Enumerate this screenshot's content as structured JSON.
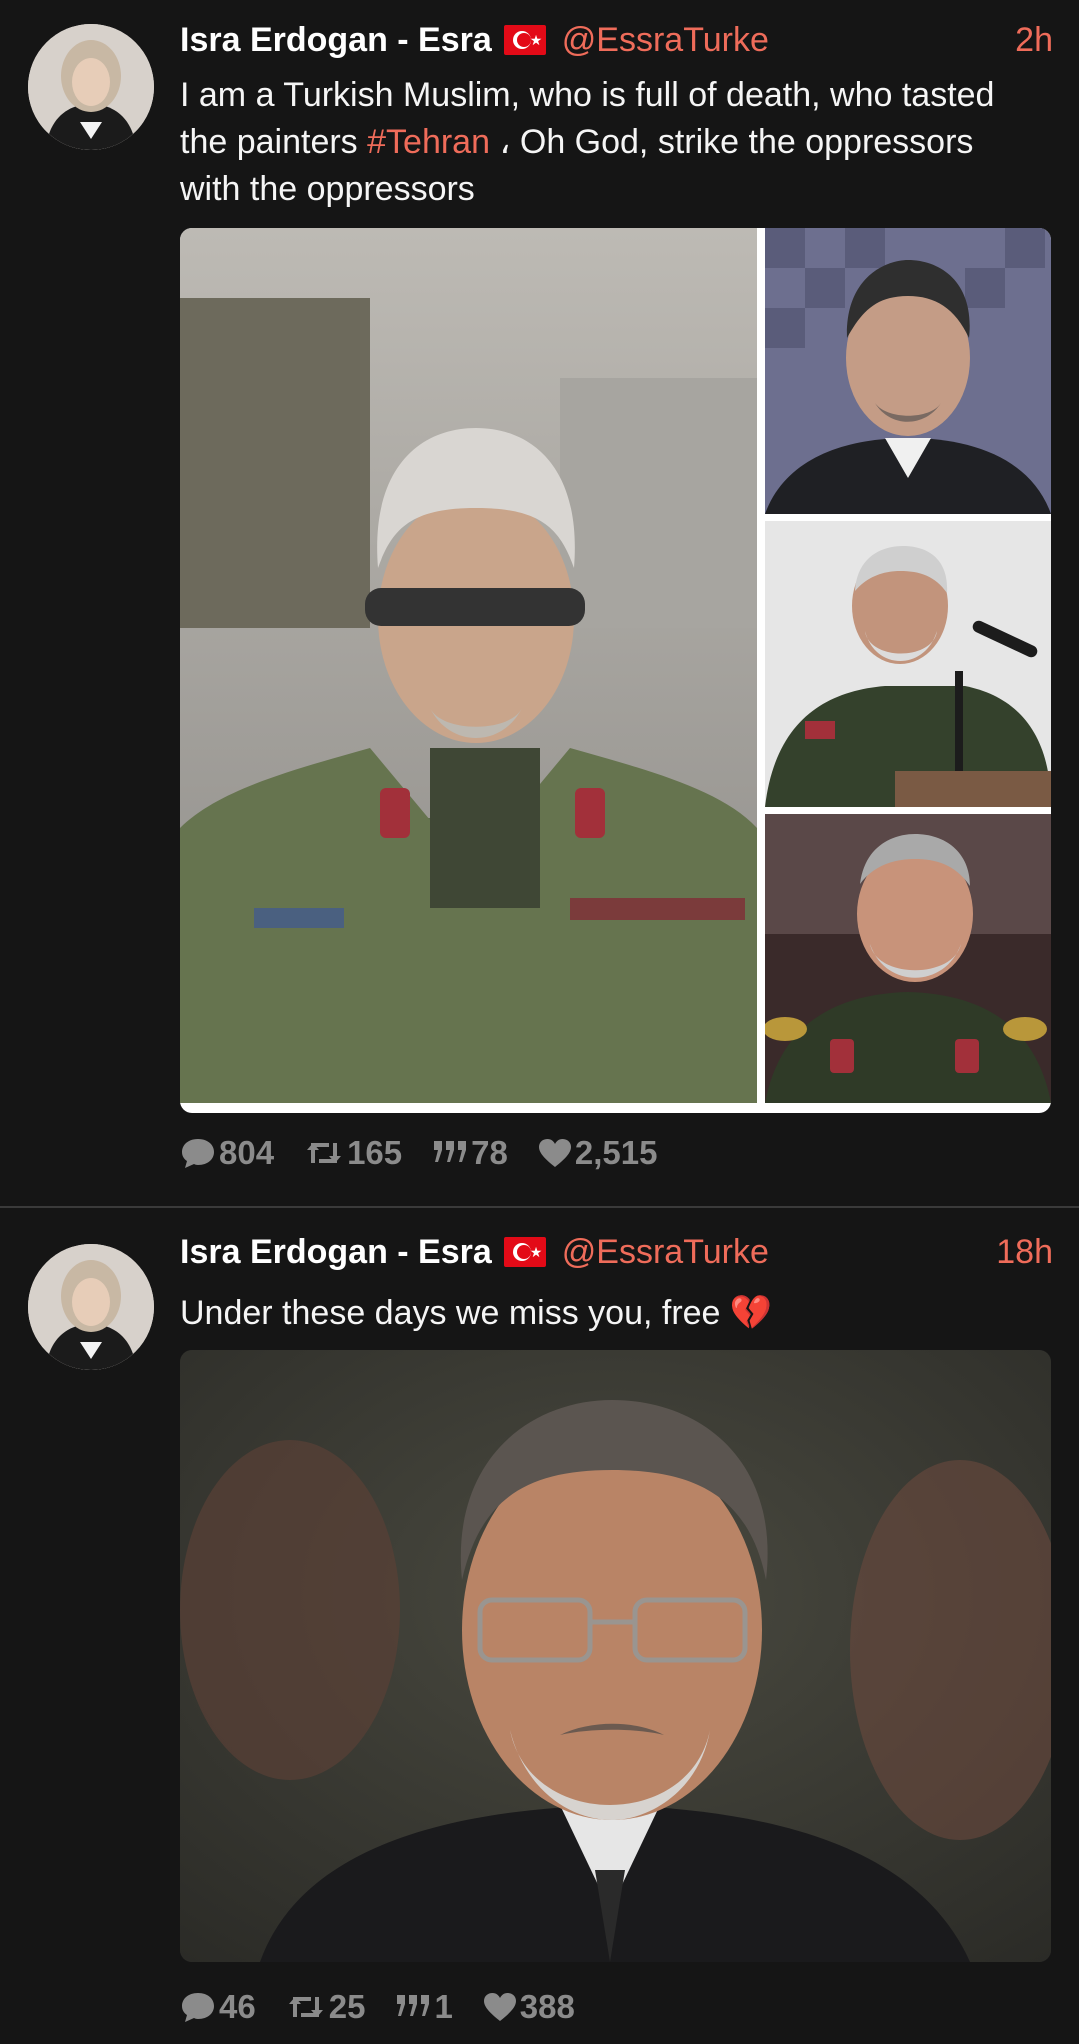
{
  "tweets": [
    {
      "author_name": "Isra Erdogan - Esra",
      "flag_icon": "turkey-flag-icon",
      "handle": "@EssraTurke",
      "time": "2h",
      "text_before": "I am a Turkish Muslim, who is full of death, who tasted the painters ",
      "hashtag": "#Tehran",
      "text_after": " ، Oh God, strike the oppressors with the oppressors",
      "media_count": 4,
      "stats": {
        "replies": "804",
        "retweets": "165",
        "quotes": "78",
        "likes": "2,515"
      }
    },
    {
      "author_name": "Isra Erdogan - Esra",
      "flag_icon": "turkey-flag-icon",
      "handle": "@EssraTurke",
      "time": "18h",
      "text": "Under these days we miss you, free ",
      "emoji": "💔",
      "media_count": 1,
      "stats": {
        "replies": "46",
        "retweets": "25",
        "quotes": "1",
        "likes": "388"
      }
    }
  ],
  "colors": {
    "background": "#151515",
    "accent": "#ef6c5a",
    "muted": "#8b8b8b",
    "divider": "#3a3a3a"
  }
}
